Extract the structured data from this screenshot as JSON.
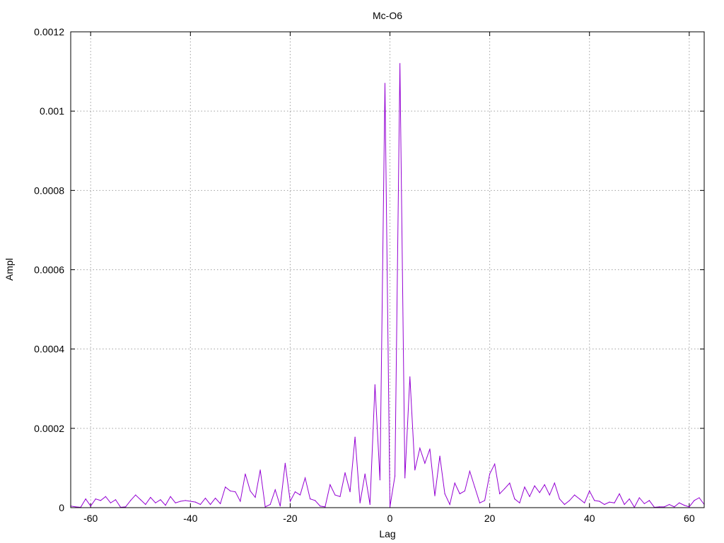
{
  "chart_data": {
    "type": "line",
    "title": "Mc-O6",
    "xlabel": "Lag",
    "ylabel": "Ampl",
    "xlim": [
      -64,
      63
    ],
    "ylim": [
      0,
      0.0012
    ],
    "grid": true,
    "x_ticks": [
      -60,
      -40,
      -20,
      0,
      20,
      40,
      60
    ],
    "x_tick_labels": [
      "-60",
      "-40",
      "-20",
      "0",
      "20",
      "40",
      "60"
    ],
    "y_ticks": [
      0,
      0.0002,
      0.0004,
      0.0006,
      0.0008,
      0.001,
      0.0012
    ],
    "y_tick_labels": [
      "0",
      "0.0002",
      "0.0004",
      "0.0006",
      "0.0008",
      "0.001",
      "0.0012"
    ],
    "series": [
      {
        "color": "#9400d3",
        "x": [
          -64,
          -63,
          -62,
          -61,
          -60,
          -59,
          -58,
          -57,
          -56,
          -55,
          -54,
          -53,
          -52,
          -51,
          -50,
          -49,
          -48,
          -47,
          -46,
          -45,
          -44,
          -43,
          -42,
          -41,
          -40,
          -39,
          -38,
          -37,
          -36,
          -35,
          -34,
          -33,
          -32,
          -31,
          -30,
          -29,
          -28,
          -27,
          -26,
          -25,
          -24,
          -23,
          -22,
          -21,
          -20,
          -19,
          -18,
          -17,
          -16,
          -15,
          -14,
          -13,
          -12,
          -11,
          -10,
          -9,
          -8,
          -7,
          -6,
          -5,
          -4,
          -3,
          -2,
          -1,
          0,
          1,
          2,
          3,
          4,
          5,
          6,
          7,
          8,
          9,
          10,
          11,
          12,
          13,
          14,
          15,
          16,
          17,
          18,
          19,
          20,
          21,
          22,
          23,
          24,
          25,
          26,
          27,
          28,
          29,
          30,
          31,
          32,
          33,
          34,
          35,
          36,
          37,
          38,
          39,
          40,
          41,
          42,
          43,
          44,
          45,
          46,
          47,
          48,
          49,
          50,
          51,
          52,
          53,
          54,
          55,
          56,
          57,
          58,
          59,
          60,
          61,
          62,
          63
        ],
        "y": [
          4e-06,
          2e-06,
          1e-06,
          2.2e-05,
          4e-06,
          2.2e-05,
          1.8e-05,
          2.8e-05,
          1.2e-05,
          2e-05,
          1e-06,
          2e-06,
          1.8e-05,
          3.2e-05,
          2e-05,
          8e-06,
          2.6e-05,
          1.2e-05,
          2e-05,
          6e-06,
          2.8e-05,
          1.2e-05,
          1.6e-05,
          1.8e-05,
          1.6e-05,
          1.4e-05,
          8e-06,
          2.4e-05,
          8e-06,
          2.4e-05,
          1e-05,
          5.2e-05,
          4.2e-05,
          4e-05,
          1.6e-05,
          8.5e-05,
          4.2e-05,
          2.6e-05,
          9.5e-05,
          2e-06,
          8e-06,
          4.5e-05,
          4e-06,
          0.000112,
          1.6e-05,
          4e-05,
          3.2e-05,
          7.5e-05,
          2.2e-05,
          1.8e-05,
          4e-06,
          2e-06,
          5.8e-05,
          3.2e-05,
          2.8e-05,
          8.8e-05,
          4e-05,
          0.000178,
          1.2e-05,
          8.5e-05,
          8e-06,
          0.00031,
          7e-05,
          0.00107,
          2e-06,
          8e-05,
          0.00112,
          7.5e-05,
          0.00033,
          9.5e-05,
          0.00015,
          0.000112,
          0.000148,
          3e-05,
          0.00013,
          3.5e-05,
          8e-06,
          6.2e-05,
          3.5e-05,
          4.2e-05,
          9.2e-05,
          5.2e-05,
          1.2e-05,
          1.8e-05,
          8.5e-05,
          0.00011,
          3.5e-05,
          4.8e-05,
          6.2e-05,
          2.2e-05,
          1.2e-05,
          5.2e-05,
          2.8e-05,
          5.5e-05,
          3.8e-05,
          5.8e-05,
          3.2e-05,
          6.2e-05,
          2.2e-05,
          8e-06,
          1.8e-05,
          3.2e-05,
          2.2e-05,
          1.2e-05,
          4.2e-05,
          1.8e-05,
          1.6e-05,
          8e-06,
          1.4e-05,
          1.2e-05,
          3.5e-05,
          8e-06,
          2.2e-05,
          1e-06,
          2.5e-05,
          1e-05,
          1.8e-05,
          1e-06,
          2e-06,
          2e-06,
          8e-06,
          2e-06,
          1.2e-05,
          6e-06,
          2e-06,
          1.8e-05,
          2.5e-05,
          8e-06
        ]
      }
    ]
  }
}
